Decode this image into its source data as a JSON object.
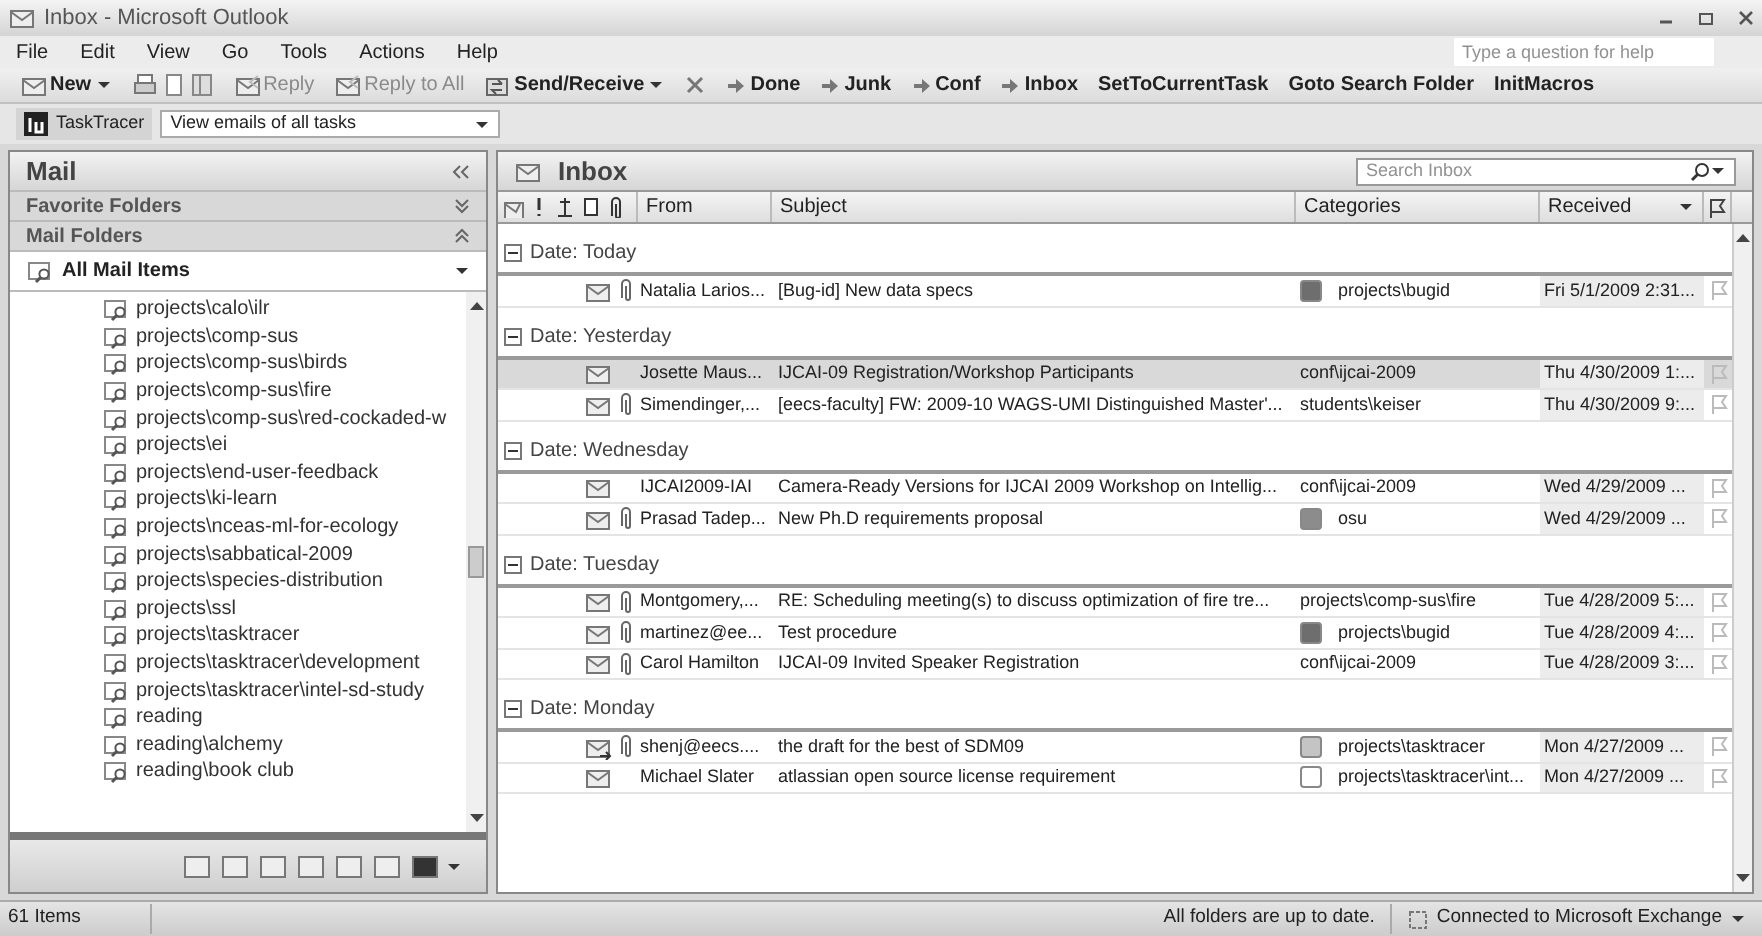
{
  "window": {
    "title": "Inbox - Microsoft Outlook"
  },
  "menu": [
    "File",
    "Edit",
    "View",
    "Go",
    "Tools",
    "Actions",
    "Help"
  ],
  "help_box": {
    "placeholder": "Type a question for help"
  },
  "toolbar": [
    {
      "kind": "new",
      "label": "New",
      "disabled": false
    },
    {
      "kind": "icon",
      "disabled": false
    },
    {
      "kind": "reply",
      "label": "Reply",
      "disabled": true
    },
    {
      "kind": "reply",
      "label": "Reply to All",
      "disabled": true
    },
    {
      "kind": "send",
      "label": "Send/Receive",
      "disabled": false
    },
    {
      "kind": "delete",
      "disabled": false
    },
    {
      "kind": "move",
      "label": "Done",
      "disabled": false
    },
    {
      "kind": "move",
      "label": "Junk",
      "disabled": false
    },
    {
      "kind": "move",
      "label": "Conf",
      "disabled": false
    },
    {
      "kind": "move",
      "label": "Inbox",
      "disabled": false
    },
    {
      "kind": "text",
      "label": "SetToCurrentTask",
      "disabled": false
    },
    {
      "kind": "text",
      "label": "Goto Search Folder",
      "disabled": false
    },
    {
      "kind": "text",
      "label": "InitMacros",
      "disabled": false
    }
  ],
  "tasktracer": {
    "label": "TaskTracer",
    "value": "View emails of all tasks"
  },
  "nav": {
    "title": "Mail",
    "sections": [
      "Favorite Folders",
      "Mail Folders"
    ],
    "current": "All Mail Items",
    "folders": [
      "projects\\calo\\ilr",
      "projects\\comp-sus",
      "projects\\comp-sus\\birds",
      "projects\\comp-sus\\fire",
      "projects\\comp-sus\\red-cockaded-w",
      "projects\\ei",
      "projects\\end-user-feedback",
      "projects\\ki-learn",
      "projects\\nceas-ml-for-ecology",
      "projects\\sabbatical-2009",
      "projects\\species-distribution",
      "projects\\ssl",
      "projects\\tasktracer",
      "projects\\tasktracer\\development",
      "projects\\tasktracer\\intel-sd-study",
      "reading",
      "reading\\alchemy",
      "reading\\book club"
    ]
  },
  "inbox": {
    "title": "Inbox",
    "search": {
      "placeholder": "Search Inbox"
    },
    "columns": [
      "From",
      "Subject",
      "Categories",
      "Received"
    ],
    "groups": [
      {
        "label": "Date: Today",
        "rows": [
          {
            "from": "Natalia Larios...",
            "subject": "[Bug-id] New data specs",
            "category": "projects\\bugid",
            "color": "#6e6e6e",
            "received": "Fri 5/1/2009 2:31...",
            "attachment": true,
            "replied": false,
            "selected": false
          }
        ]
      },
      {
        "label": "Date: Yesterday",
        "rows": [
          {
            "from": "Josette Maus...",
            "subject": "IJCAI-09 Registration/Workshop Participants",
            "category": "conf\\ijcai-2009",
            "received": "Thu 4/30/2009 1:...",
            "attachment": false,
            "replied": false,
            "selected": true
          },
          {
            "from": "Simendinger,...",
            "subject": "[eecs-faculty] FW: 2009-10 WAGS-UMI Distinguished Master'...",
            "category": "students\\keiser",
            "received": "Thu 4/30/2009 9:...",
            "attachment": true,
            "replied": false,
            "selected": false
          }
        ]
      },
      {
        "label": "Date: Wednesday",
        "rows": [
          {
            "from": "IJCAI2009-IAI",
            "subject": "Camera-Ready Versions for IJCAI 2009 Workshop on Intellig...",
            "category": "conf\\ijcai-2009",
            "received": "Wed 4/29/2009 ...",
            "attachment": false,
            "replied": false,
            "selected": false
          },
          {
            "from": "Prasad Tadep...",
            "subject": "New Ph.D requirements proposal",
            "category": "osu",
            "color": "#8c8c8c",
            "received": "Wed 4/29/2009 ...",
            "attachment": true,
            "replied": false,
            "selected": false
          }
        ]
      },
      {
        "label": "Date: Tuesday",
        "rows": [
          {
            "from": "Montgomery,...",
            "subject": "RE: Scheduling meeting(s) to discuss optimization of fire tre...",
            "category": "projects\\comp-sus\\fire",
            "received": "Tue 4/28/2009 5:...",
            "attachment": true,
            "replied": false,
            "selected": false
          },
          {
            "from": "martinez@ee...",
            "subject": "Test procedure",
            "category": "projects\\bugid",
            "color": "#6e6e6e",
            "received": "Tue 4/28/2009 4:...",
            "attachment": true,
            "replied": false,
            "selected": false
          },
          {
            "from": "Carol Hamilton",
            "subject": "IJCAI-09 Invited Speaker Registration",
            "category": "conf\\ijcai-2009",
            "received": "Tue 4/28/2009 3:...",
            "attachment": true,
            "replied": false,
            "selected": false
          }
        ]
      },
      {
        "label": "Date: Monday",
        "rows": [
          {
            "from": "shenj@eecs....",
            "subject": "the draft for the best of SDM09",
            "category": "projects\\tasktracer",
            "color": "#c4c4c4",
            "received": "Mon 4/27/2009 ...",
            "attachment": true,
            "replied": true,
            "selected": false
          },
          {
            "from": "Michael Slater",
            "subject": "atlassian open source license requirement",
            "category": "projects\\tasktracer\\int...",
            "color": "#ffffff",
            "received": "Mon 4/27/2009 ...",
            "attachment": false,
            "replied": false,
            "selected": false
          }
        ]
      }
    ]
  },
  "status_bar": {
    "count": "61 Items",
    "sync": "All folders are up to date.",
    "connection": "Connected to Microsoft Exchange"
  }
}
